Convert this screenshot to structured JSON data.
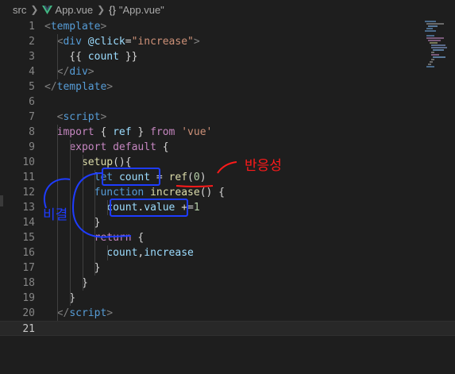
{
  "breadcrumb": {
    "folder": "src",
    "file": "App.vue",
    "symbol_braces": "{}",
    "symbol": "\"App.vue\""
  },
  "editor": {
    "active_line": "21",
    "lines": [
      {
        "n": "1",
        "tokens": [
          [
            "tag",
            "<"
          ],
          [
            "tagname",
            "template"
          ],
          [
            "tag",
            ">"
          ]
        ]
      },
      {
        "n": "2",
        "tokens": [
          [
            "plain",
            "  "
          ],
          [
            "tag",
            "<"
          ],
          [
            "tagname",
            "div"
          ],
          [
            "plain",
            " "
          ],
          [
            "attr",
            "@click"
          ],
          [
            "plain",
            "="
          ],
          [
            "str",
            "\"increase\""
          ],
          [
            "tag",
            ">"
          ]
        ]
      },
      {
        "n": "3",
        "tokens": [
          [
            "plain",
            "    {{ "
          ],
          [
            "var",
            "count"
          ],
          [
            "plain",
            " }}"
          ]
        ]
      },
      {
        "n": "4",
        "tokens": [
          [
            "plain",
            "  "
          ],
          [
            "tag",
            "</"
          ],
          [
            "tagname",
            "div"
          ],
          [
            "tag",
            ">"
          ]
        ]
      },
      {
        "n": "5",
        "tokens": [
          [
            "tag",
            "</"
          ],
          [
            "tagname",
            "template"
          ],
          [
            "tag",
            ">"
          ]
        ]
      },
      {
        "n": "6",
        "tokens": []
      },
      {
        "n": "7",
        "tokens": [
          [
            "plain",
            "  "
          ],
          [
            "tag",
            "<"
          ],
          [
            "tagname",
            "script"
          ],
          [
            "tag",
            ">"
          ]
        ]
      },
      {
        "n": "8",
        "tokens": [
          [
            "plain",
            "  "
          ],
          [
            "kw",
            "import"
          ],
          [
            "plain",
            " { "
          ],
          [
            "var",
            "ref"
          ],
          [
            "plain",
            " } "
          ],
          [
            "kw",
            "from"
          ],
          [
            "plain",
            " "
          ],
          [
            "str",
            "'vue'"
          ]
        ]
      },
      {
        "n": "9",
        "tokens": [
          [
            "plain",
            "    "
          ],
          [
            "kw",
            "export"
          ],
          [
            "plain",
            " "
          ],
          [
            "kw",
            "default"
          ],
          [
            "plain",
            " {"
          ]
        ]
      },
      {
        "n": "10",
        "tokens": [
          [
            "plain",
            "      "
          ],
          [
            "fn",
            "setup"
          ],
          [
            "plain",
            "(){"
          ]
        ]
      },
      {
        "n": "11",
        "tokens": [
          [
            "plain",
            "        "
          ],
          [
            "kw2",
            "let"
          ],
          [
            "plain",
            " "
          ],
          [
            "var",
            "count"
          ],
          [
            "plain",
            " = "
          ],
          [
            "fn",
            "ref"
          ],
          [
            "plain",
            "("
          ],
          [
            "num",
            "0"
          ],
          [
            "plain",
            ")"
          ]
        ]
      },
      {
        "n": "12",
        "tokens": [
          [
            "plain",
            "        "
          ],
          [
            "kw2",
            "function"
          ],
          [
            "plain",
            " "
          ],
          [
            "fn",
            "increase"
          ],
          [
            "plain",
            "() {"
          ]
        ]
      },
      {
        "n": "13",
        "tokens": [
          [
            "plain",
            "          "
          ],
          [
            "var",
            "count"
          ],
          [
            "plain",
            "."
          ],
          [
            "var",
            "value"
          ],
          [
            "plain",
            " +="
          ],
          [
            "num",
            "1"
          ]
        ]
      },
      {
        "n": "14",
        "tokens": [
          [
            "plain",
            "        }"
          ]
        ]
      },
      {
        "n": "15",
        "tokens": [
          [
            "plain",
            "        "
          ],
          [
            "kw",
            "return"
          ],
          [
            "plain",
            " {"
          ]
        ]
      },
      {
        "n": "16",
        "tokens": [
          [
            "plain",
            "          "
          ],
          [
            "var",
            "count"
          ],
          [
            "plain",
            ","
          ],
          [
            "var",
            "increase"
          ]
        ]
      },
      {
        "n": "17",
        "tokens": [
          [
            "plain",
            "        }"
          ]
        ]
      },
      {
        "n": "18",
        "tokens": [
          [
            "plain",
            "      }"
          ]
        ]
      },
      {
        "n": "19",
        "tokens": [
          [
            "plain",
            "    }"
          ]
        ]
      },
      {
        "n": "20",
        "tokens": [
          [
            "plain",
            "  "
          ],
          [
            "tag",
            "</"
          ],
          [
            "tagname",
            "script"
          ],
          [
            "tag",
            ">"
          ]
        ]
      },
      {
        "n": "21",
        "tokens": []
      }
    ]
  },
  "annotations": {
    "reactivity_label": "반응성",
    "left_label": "비결"
  },
  "colors": {
    "background": "#1e1e1e",
    "annotation_blue": "#1e3cff",
    "annotation_red": "#ff1a1a"
  }
}
